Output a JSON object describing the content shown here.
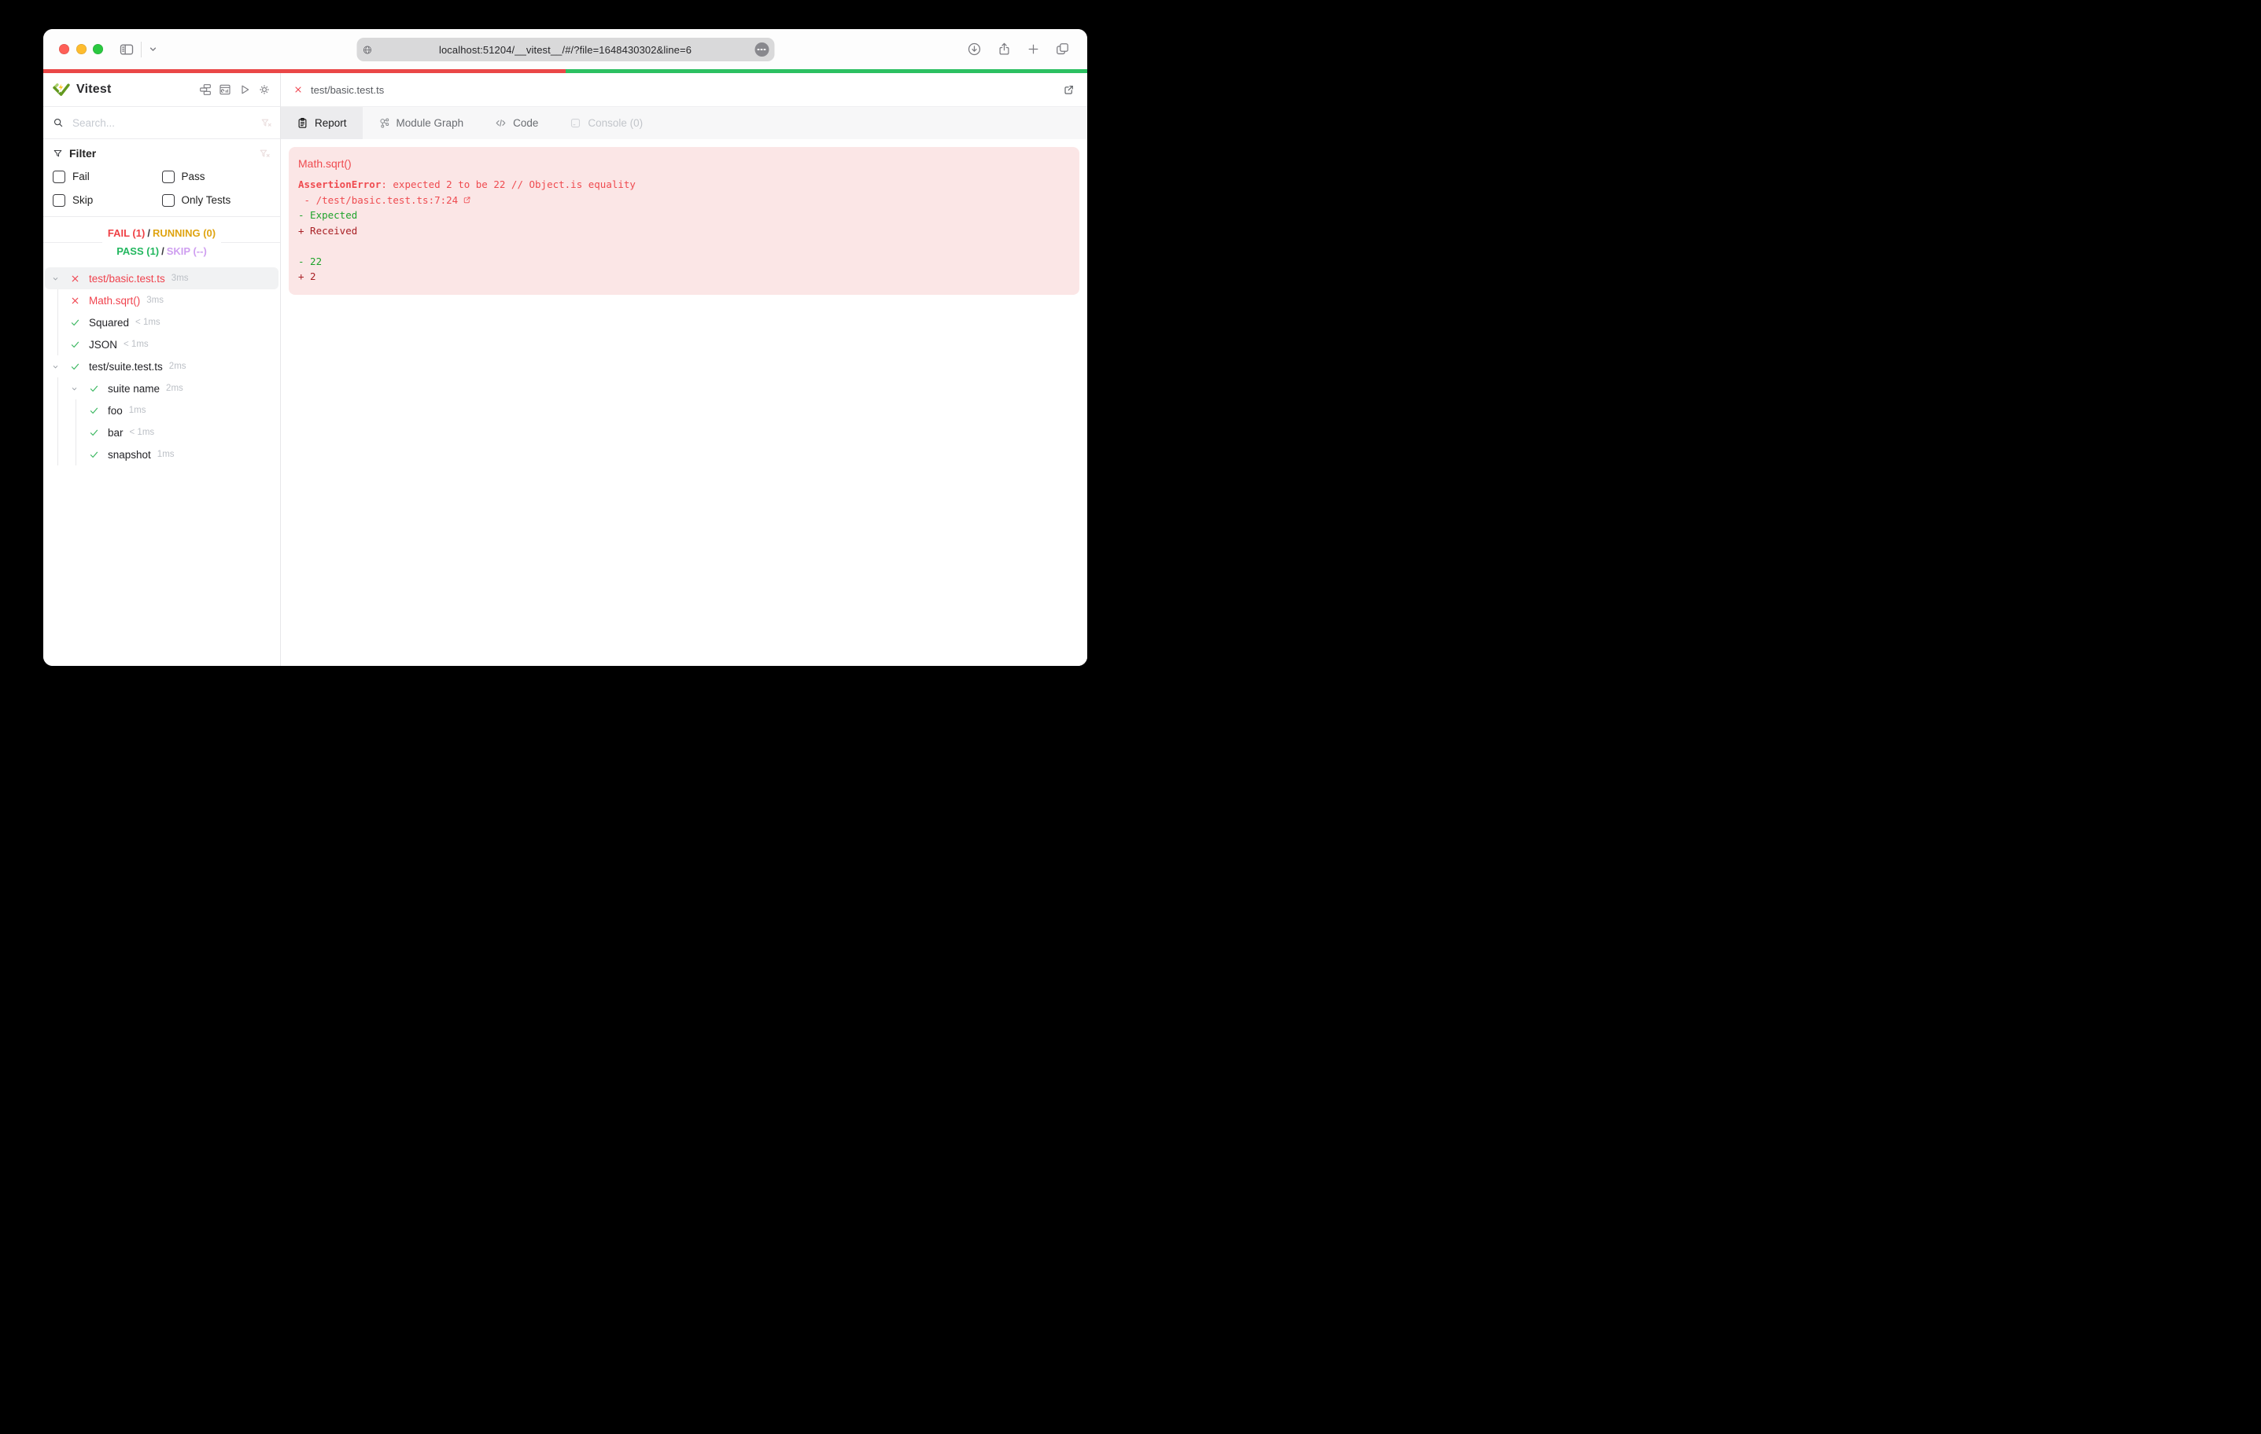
{
  "browser": {
    "url": "localhost:51204/__vitest__/#/?file=1648430302&line=6",
    "traffic_lights": [
      "#ff5f57",
      "#febc2e",
      "#2ac840"
    ]
  },
  "progress": {
    "fail_fraction": 0.5,
    "pass_fraction": 0.5
  },
  "colors": {
    "fail": "#ef4146",
    "pass": "#23b75f",
    "running": "#dfa412",
    "skip": "#cf9ff0",
    "progress_fail": "#ea4747",
    "progress_pass": "#2cc062",
    "error_bg": "#fbe6e6"
  },
  "sidebar": {
    "title": "Vitest",
    "search_placeholder": "Search...",
    "filter": {
      "label": "Filter",
      "options": [
        {
          "label": "Fail",
          "checked": false
        },
        {
          "label": "Pass",
          "checked": false
        },
        {
          "label": "Skip",
          "checked": false
        },
        {
          "label": "Only Tests",
          "checked": false
        }
      ]
    },
    "summary": {
      "fail": "FAIL (1)",
      "running": "RUNNING (0)",
      "pass": "PASS (1)",
      "skip": "SKIP (--)",
      "separator": "/"
    },
    "tree": [
      {
        "label": "test/basic.test.ts",
        "duration": "3ms",
        "status": "fail",
        "level": 0,
        "chevron": true,
        "selected": true
      },
      {
        "label": "Math.sqrt()",
        "duration": "3ms",
        "status": "fail",
        "level": 1,
        "chevron": false,
        "selected": false
      },
      {
        "label": "Squared",
        "duration": "< 1ms",
        "status": "pass",
        "level": 1,
        "chevron": false,
        "selected": false
      },
      {
        "label": "JSON",
        "duration": "< 1ms",
        "status": "pass",
        "level": 1,
        "chevron": false,
        "selected": false
      },
      {
        "label": "test/suite.test.ts",
        "duration": "2ms",
        "status": "pass",
        "level": 0,
        "chevron": true,
        "selected": false
      },
      {
        "label": "suite name",
        "duration": "2ms",
        "status": "pass",
        "level": 1,
        "chevron": true,
        "selected": false
      },
      {
        "label": "foo",
        "duration": "1ms",
        "status": "pass",
        "level": 2,
        "chevron": false,
        "selected": false
      },
      {
        "label": "bar",
        "duration": "< 1ms",
        "status": "pass",
        "level": 2,
        "chevron": false,
        "selected": false
      },
      {
        "label": "snapshot",
        "duration": "1ms",
        "status": "pass",
        "level": 2,
        "chevron": false,
        "selected": false
      }
    ]
  },
  "main": {
    "file_tab": {
      "label": "test/basic.test.ts"
    },
    "tabs": [
      {
        "label": "Report",
        "icon": "report",
        "state": "active"
      },
      {
        "label": "Module Graph",
        "icon": "module-graph",
        "state": "normal"
      },
      {
        "label": "Code",
        "icon": "code",
        "state": "normal"
      },
      {
        "label": "Console (0)",
        "icon": "console",
        "state": "disabled"
      }
    ],
    "report": {
      "test_name": "Math.sqrt()",
      "error_bold": "AssertionError",
      "error_rest": ": expected 2 to be 22 // Object.is equality",
      "stack_line": " - /test/basic.test.ts:7:24",
      "diff_expected_label": "- Expected",
      "diff_received_label": "+ Received",
      "diff_expected_value": "- 22",
      "diff_received_value": "+ 2"
    }
  }
}
